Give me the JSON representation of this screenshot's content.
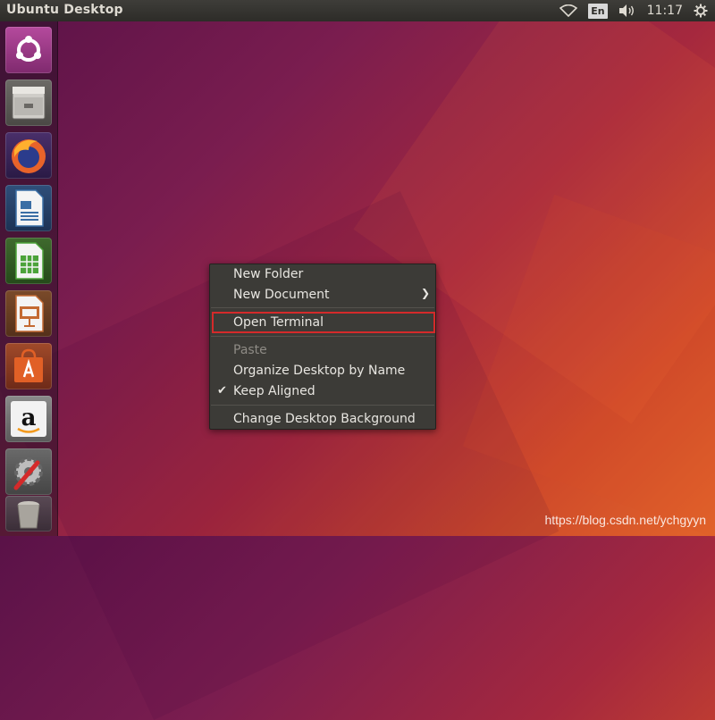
{
  "top_panel": {
    "title": "Ubuntu Desktop",
    "keyboard_indicator": "En",
    "clock": "11:17",
    "icons": [
      "wifi-icon",
      "volume-icon",
      "power-gear-icon"
    ]
  },
  "launcher": {
    "items": [
      {
        "name": "Ubuntu Dash",
        "icon": "ubuntu-logo-icon",
        "color": "#9b3a86"
      },
      {
        "name": "Files",
        "icon": "file-cabinet-icon",
        "color": "#8a8883"
      },
      {
        "name": "Firefox",
        "icon": "firefox-icon",
        "color": "#e8632a"
      },
      {
        "name": "LibreOffice Writer",
        "icon": "writer-document-icon",
        "color": "#3a6ea5"
      },
      {
        "name": "LibreOffice Calc",
        "icon": "calc-spreadsheet-icon",
        "color": "#4ca33a"
      },
      {
        "name": "LibreOffice Impress",
        "icon": "impress-presentation-icon",
        "color": "#c46a32"
      },
      {
        "name": "Ubuntu Software",
        "icon": "software-bag-icon",
        "color": "#e16026"
      },
      {
        "name": "Amazon",
        "icon": "amazon-logo-icon",
        "color": "#e6e6e6"
      },
      {
        "name": "System Settings",
        "icon": "settings-wrench-icon",
        "color": "#7a7a7a"
      },
      {
        "name": "Trash",
        "icon": "trash-icon",
        "color": "#5a4a55"
      }
    ]
  },
  "context_menu": {
    "items": [
      {
        "label": "New Folder",
        "enabled": true
      },
      {
        "label": "New Document",
        "enabled": true,
        "submenu": true
      },
      {
        "label": "Open Terminal",
        "enabled": true,
        "highlighted": true
      },
      {
        "label": "Paste",
        "enabled": false
      },
      {
        "label": "Organize Desktop by Name",
        "enabled": true
      },
      {
        "label": "Keep Aligned",
        "enabled": true,
        "checked": true
      },
      {
        "label": "Change Desktop Background",
        "enabled": true
      }
    ],
    "highlight_color": "#d42a2a"
  },
  "watermark": "https://blog.csdn.net/ychgyyn"
}
